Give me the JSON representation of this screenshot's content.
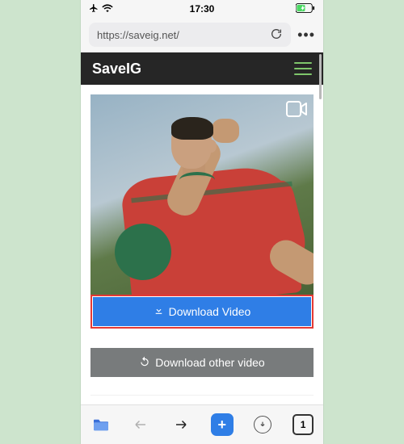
{
  "status": {
    "time": "17:30"
  },
  "browser": {
    "url": "https://saveig.net/"
  },
  "site": {
    "brand": "SaveIG"
  },
  "buttons": {
    "download": "Download Video",
    "other": "Download other video"
  },
  "toolbar": {
    "tab_count": "1",
    "plus": "+"
  }
}
